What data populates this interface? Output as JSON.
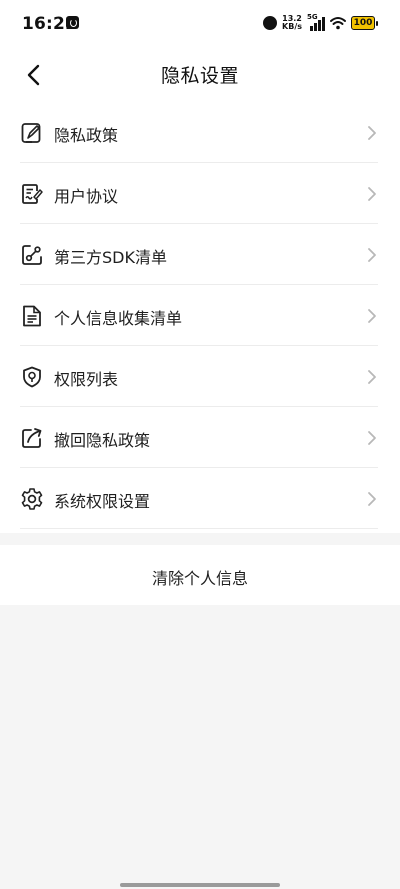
{
  "status_bar": {
    "time": "16:22",
    "net_speed_value": "13.2",
    "net_speed_unit": "KB/s",
    "network_type": "5G",
    "battery_level": "100",
    "battery_color": "#f2c200"
  },
  "header": {
    "title": "隐私设置",
    "back_icon": "chevron-left-icon"
  },
  "menu": {
    "items": [
      {
        "label": "隐私政策",
        "icon": "document-edit-icon"
      },
      {
        "label": "用户协议",
        "icon": "agreement-icon"
      },
      {
        "label": "第三方SDK清单",
        "icon": "sdk-link-icon"
      },
      {
        "label": "个人信息收集清单",
        "icon": "file-list-icon"
      },
      {
        "label": "权限列表",
        "icon": "shield-icon"
      },
      {
        "label": "撤回隐私政策",
        "icon": "withdraw-icon"
      },
      {
        "label": "系统权限设置",
        "icon": "gear-icon"
      }
    ],
    "chevron_icon": "chevron-right-icon"
  },
  "actions": {
    "clear_personal_info": "清除个人信息"
  },
  "colors": {
    "background": "#f5f5f5",
    "surface": "#ffffff",
    "text": "#1f1f1f",
    "chevron": "#b8b8b8"
  }
}
